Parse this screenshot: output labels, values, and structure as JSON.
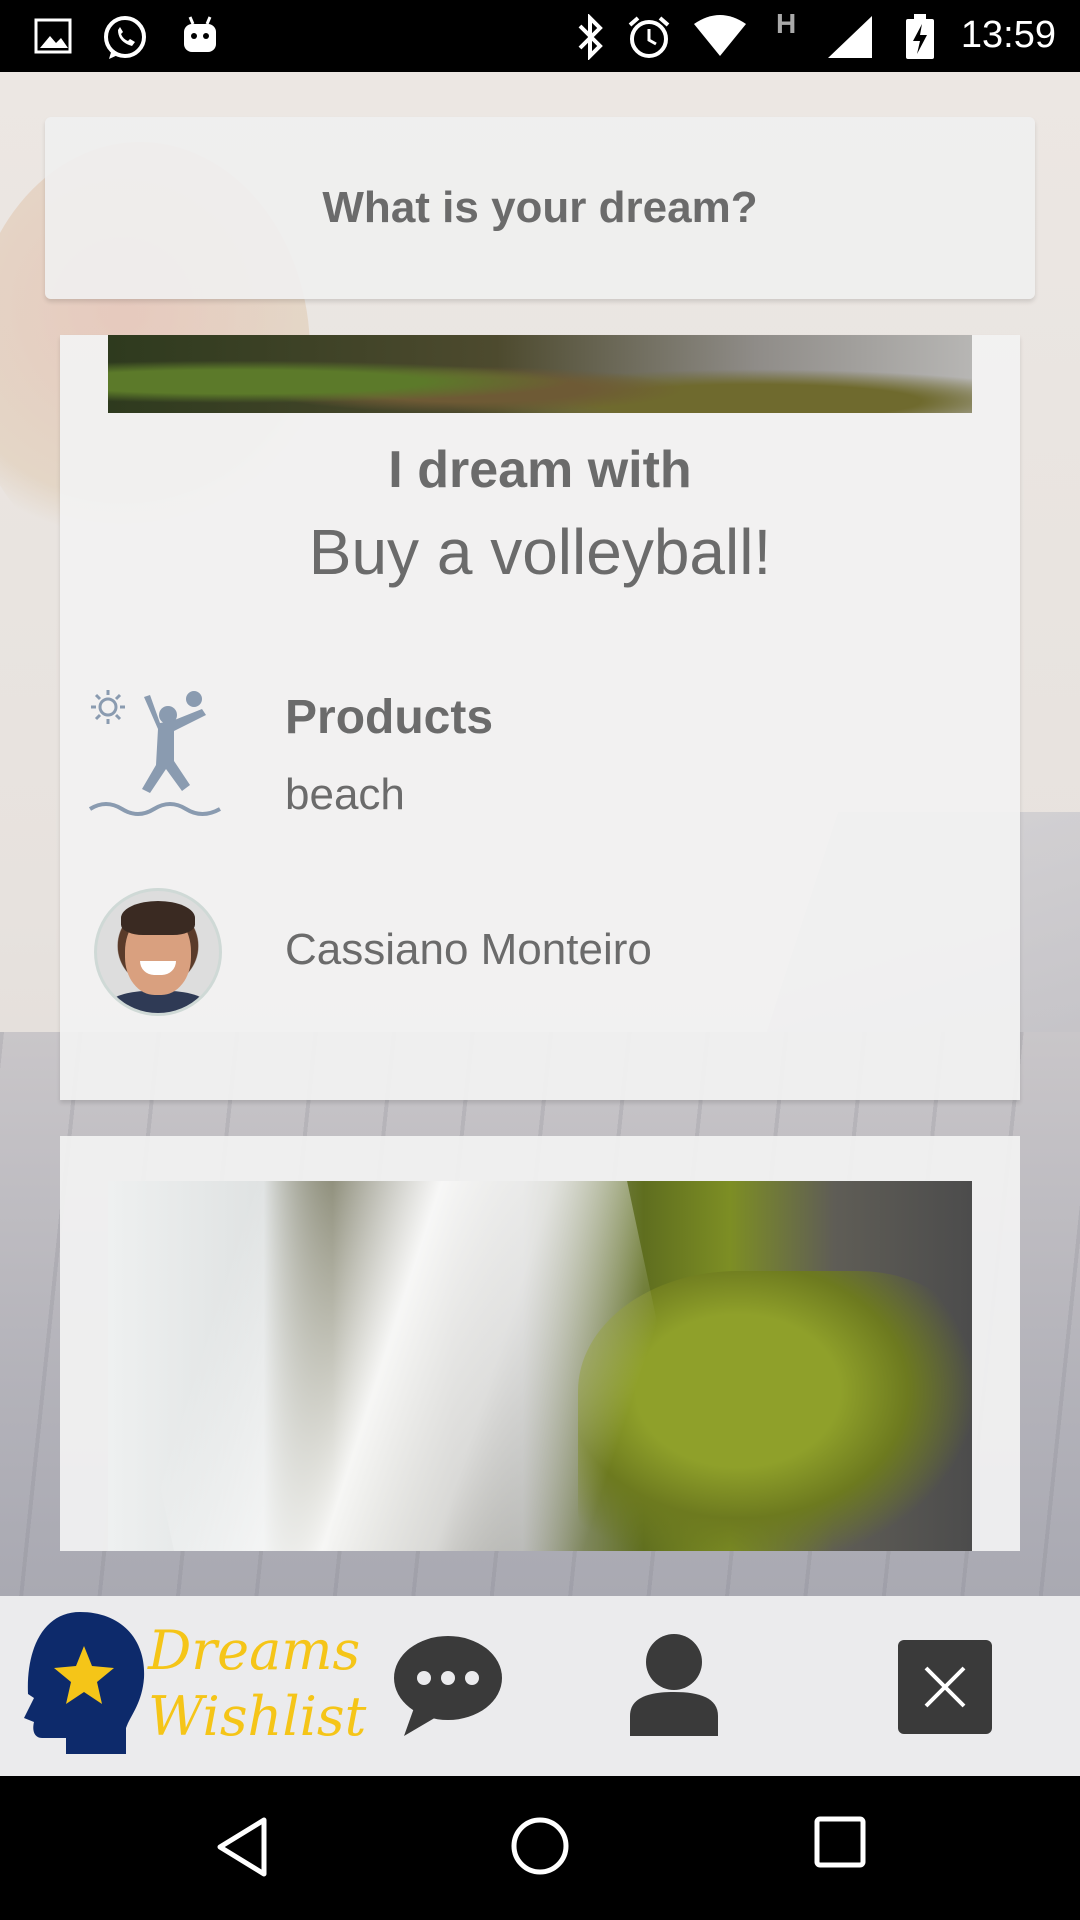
{
  "status_bar": {
    "time": "13:59",
    "left_icons": [
      "image-icon",
      "whatsapp-icon",
      "android-icon"
    ],
    "right_icons": [
      "bluetooth-icon",
      "alarm-icon",
      "wifi-icon",
      "signal-h-icon",
      "cell-signal-icon",
      "battery-charging-icon"
    ],
    "network_label": "H"
  },
  "search": {
    "prompt": "What is your dream?"
  },
  "dream_card": {
    "title": "I dream with",
    "dream": "Buy a volleyball!",
    "category_label": "Products",
    "category_value": "beach",
    "category_icon": "beach-volleyball-icon",
    "user_name": "Cassiano Monteiro"
  },
  "app_bar": {
    "logo_line1": "Dreams",
    "logo_line2": "Wishlist",
    "brand_color": "#f5c518",
    "logo_head_color": "#0d2a6b"
  },
  "nav_bar": {
    "buttons": [
      "back-icon",
      "home-icon",
      "recents-icon"
    ]
  }
}
